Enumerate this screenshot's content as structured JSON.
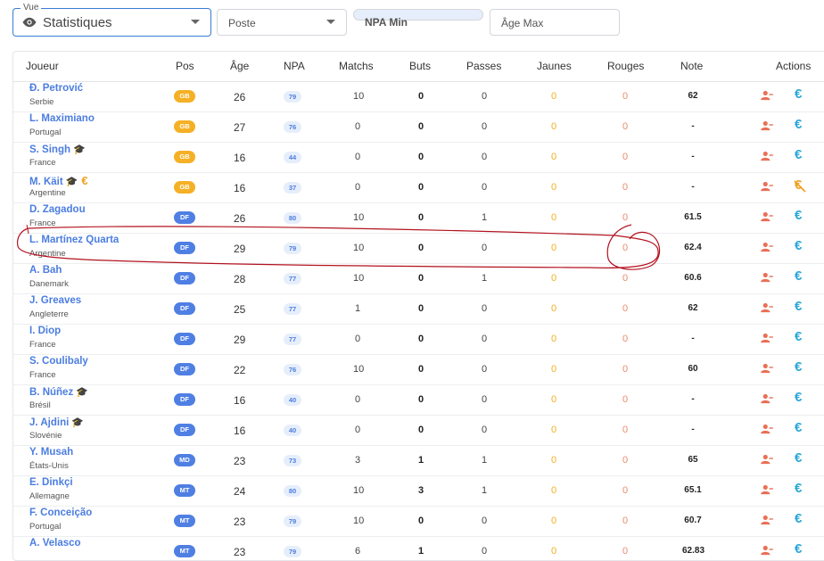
{
  "filters": {
    "vue_legend": "Vue",
    "vue_value": "Statistiques",
    "poste_placeholder": "Poste",
    "npa_min_placeholder": "NPA Min",
    "age_max_placeholder": "Âge Max"
  },
  "columns": [
    "Joueur",
    "Pos",
    "Âge",
    "NPA",
    "Matchs",
    "Buts",
    "Passes",
    "Jaunes",
    "Rouges",
    "Note",
    "Actions"
  ],
  "colors": {
    "accent": "#4b7de0",
    "gb": "#f5b025",
    "yellow": "#f0b021",
    "red": "#ec8a6c",
    "euro": "#2aa7d9"
  },
  "players": [
    {
      "name": "Đ. Petrović",
      "country": "Serbie",
      "pos": "GB",
      "age": "26",
      "npa": "79",
      "matchs": "10",
      "buts": "0",
      "passes": "0",
      "jaunes": "0",
      "rouges": "0",
      "note": "62",
      "cap": false,
      "eur": false,
      "eur_struck": false
    },
    {
      "name": "L. Maximiano",
      "country": "Portugal",
      "pos": "GB",
      "age": "27",
      "npa": "76",
      "matchs": "0",
      "buts": "0",
      "passes": "0",
      "jaunes": "0",
      "rouges": "0",
      "note": "-",
      "cap": false,
      "eur": false,
      "eur_struck": false
    },
    {
      "name": "S. Singh",
      "country": "France",
      "pos": "GB",
      "age": "16",
      "npa": "44",
      "matchs": "0",
      "buts": "0",
      "passes": "0",
      "jaunes": "0",
      "rouges": "0",
      "note": "-",
      "cap": true,
      "eur": false,
      "eur_struck": false
    },
    {
      "name": "M. Käit",
      "country": "Argentine",
      "pos": "GB",
      "age": "16",
      "npa": "37",
      "matchs": "0",
      "buts": "0",
      "passes": "0",
      "jaunes": "0",
      "rouges": "0",
      "note": "-",
      "cap": true,
      "eur": true,
      "eur_struck": true
    },
    {
      "name": "D. Zagadou",
      "country": "France",
      "pos": "DF",
      "age": "26",
      "npa": "80",
      "matchs": "10",
      "buts": "0",
      "passes": "1",
      "jaunes": "0",
      "rouges": "0",
      "note": "61.5",
      "cap": false,
      "eur": false,
      "eur_struck": false
    },
    {
      "name": "L. Martínez Quarta",
      "country": "Argentine",
      "pos": "DF",
      "age": "29",
      "npa": "79",
      "matchs": "10",
      "buts": "0",
      "passes": "0",
      "jaunes": "0",
      "rouges": "0",
      "note": "62.4",
      "cap": false,
      "eur": false,
      "eur_struck": false
    },
    {
      "name": "A. Bah",
      "country": "Danemark",
      "pos": "DF",
      "age": "28",
      "npa": "77",
      "matchs": "10",
      "buts": "0",
      "passes": "1",
      "jaunes": "0",
      "rouges": "0",
      "note": "60.6",
      "cap": false,
      "eur": false,
      "eur_struck": false
    },
    {
      "name": "J. Greaves",
      "country": "Angleterre",
      "pos": "DF",
      "age": "25",
      "npa": "77",
      "matchs": "1",
      "buts": "0",
      "passes": "0",
      "jaunes": "0",
      "rouges": "0",
      "note": "62",
      "cap": false,
      "eur": false,
      "eur_struck": false
    },
    {
      "name": "I. Diop",
      "country": "France",
      "pos": "DF",
      "age": "29",
      "npa": "77",
      "matchs": "0",
      "buts": "0",
      "passes": "0",
      "jaunes": "0",
      "rouges": "0",
      "note": "-",
      "cap": false,
      "eur": false,
      "eur_struck": false
    },
    {
      "name": "S. Coulibaly",
      "country": "France",
      "pos": "DF",
      "age": "22",
      "npa": "76",
      "matchs": "10",
      "buts": "0",
      "passes": "0",
      "jaunes": "0",
      "rouges": "0",
      "note": "60",
      "cap": false,
      "eur": false,
      "eur_struck": false
    },
    {
      "name": "B. Núñez",
      "country": "Brésil",
      "pos": "DF",
      "age": "16",
      "npa": "40",
      "matchs": "0",
      "buts": "0",
      "passes": "0",
      "jaunes": "0",
      "rouges": "0",
      "note": "-",
      "cap": true,
      "eur": false,
      "eur_struck": false
    },
    {
      "name": "J. Ajdini",
      "country": "Slovénie",
      "pos": "DF",
      "age": "16",
      "npa": "40",
      "matchs": "0",
      "buts": "0",
      "passes": "0",
      "jaunes": "0",
      "rouges": "0",
      "note": "-",
      "cap": true,
      "eur": false,
      "eur_struck": false
    },
    {
      "name": "Y. Musah",
      "country": "États-Unis",
      "pos": "MD",
      "age": "23",
      "npa": "73",
      "matchs": "3",
      "buts": "1",
      "passes": "1",
      "jaunes": "0",
      "rouges": "0",
      "note": "65",
      "cap": false,
      "eur": false,
      "eur_struck": false
    },
    {
      "name": "E. Dinkçi",
      "country": "Allemagne",
      "pos": "MT",
      "age": "24",
      "npa": "80",
      "matchs": "10",
      "buts": "3",
      "passes": "1",
      "jaunes": "0",
      "rouges": "0",
      "note": "65.1",
      "cap": false,
      "eur": false,
      "eur_struck": false
    },
    {
      "name": "F. Conceição",
      "country": "Portugal",
      "pos": "MT",
      "age": "23",
      "npa": "79",
      "matchs": "10",
      "buts": "0",
      "passes": "0",
      "jaunes": "0",
      "rouges": "0",
      "note": "60.7",
      "cap": false,
      "eur": false,
      "eur_struck": false
    },
    {
      "name": "A. Velasco",
      "country": "",
      "pos": "MT",
      "age": "23",
      "npa": "79",
      "matchs": "6",
      "buts": "1",
      "passes": "0",
      "jaunes": "0",
      "rouges": "0",
      "note": "62.83",
      "cap": false,
      "eur": false,
      "eur_struck": false
    }
  ]
}
